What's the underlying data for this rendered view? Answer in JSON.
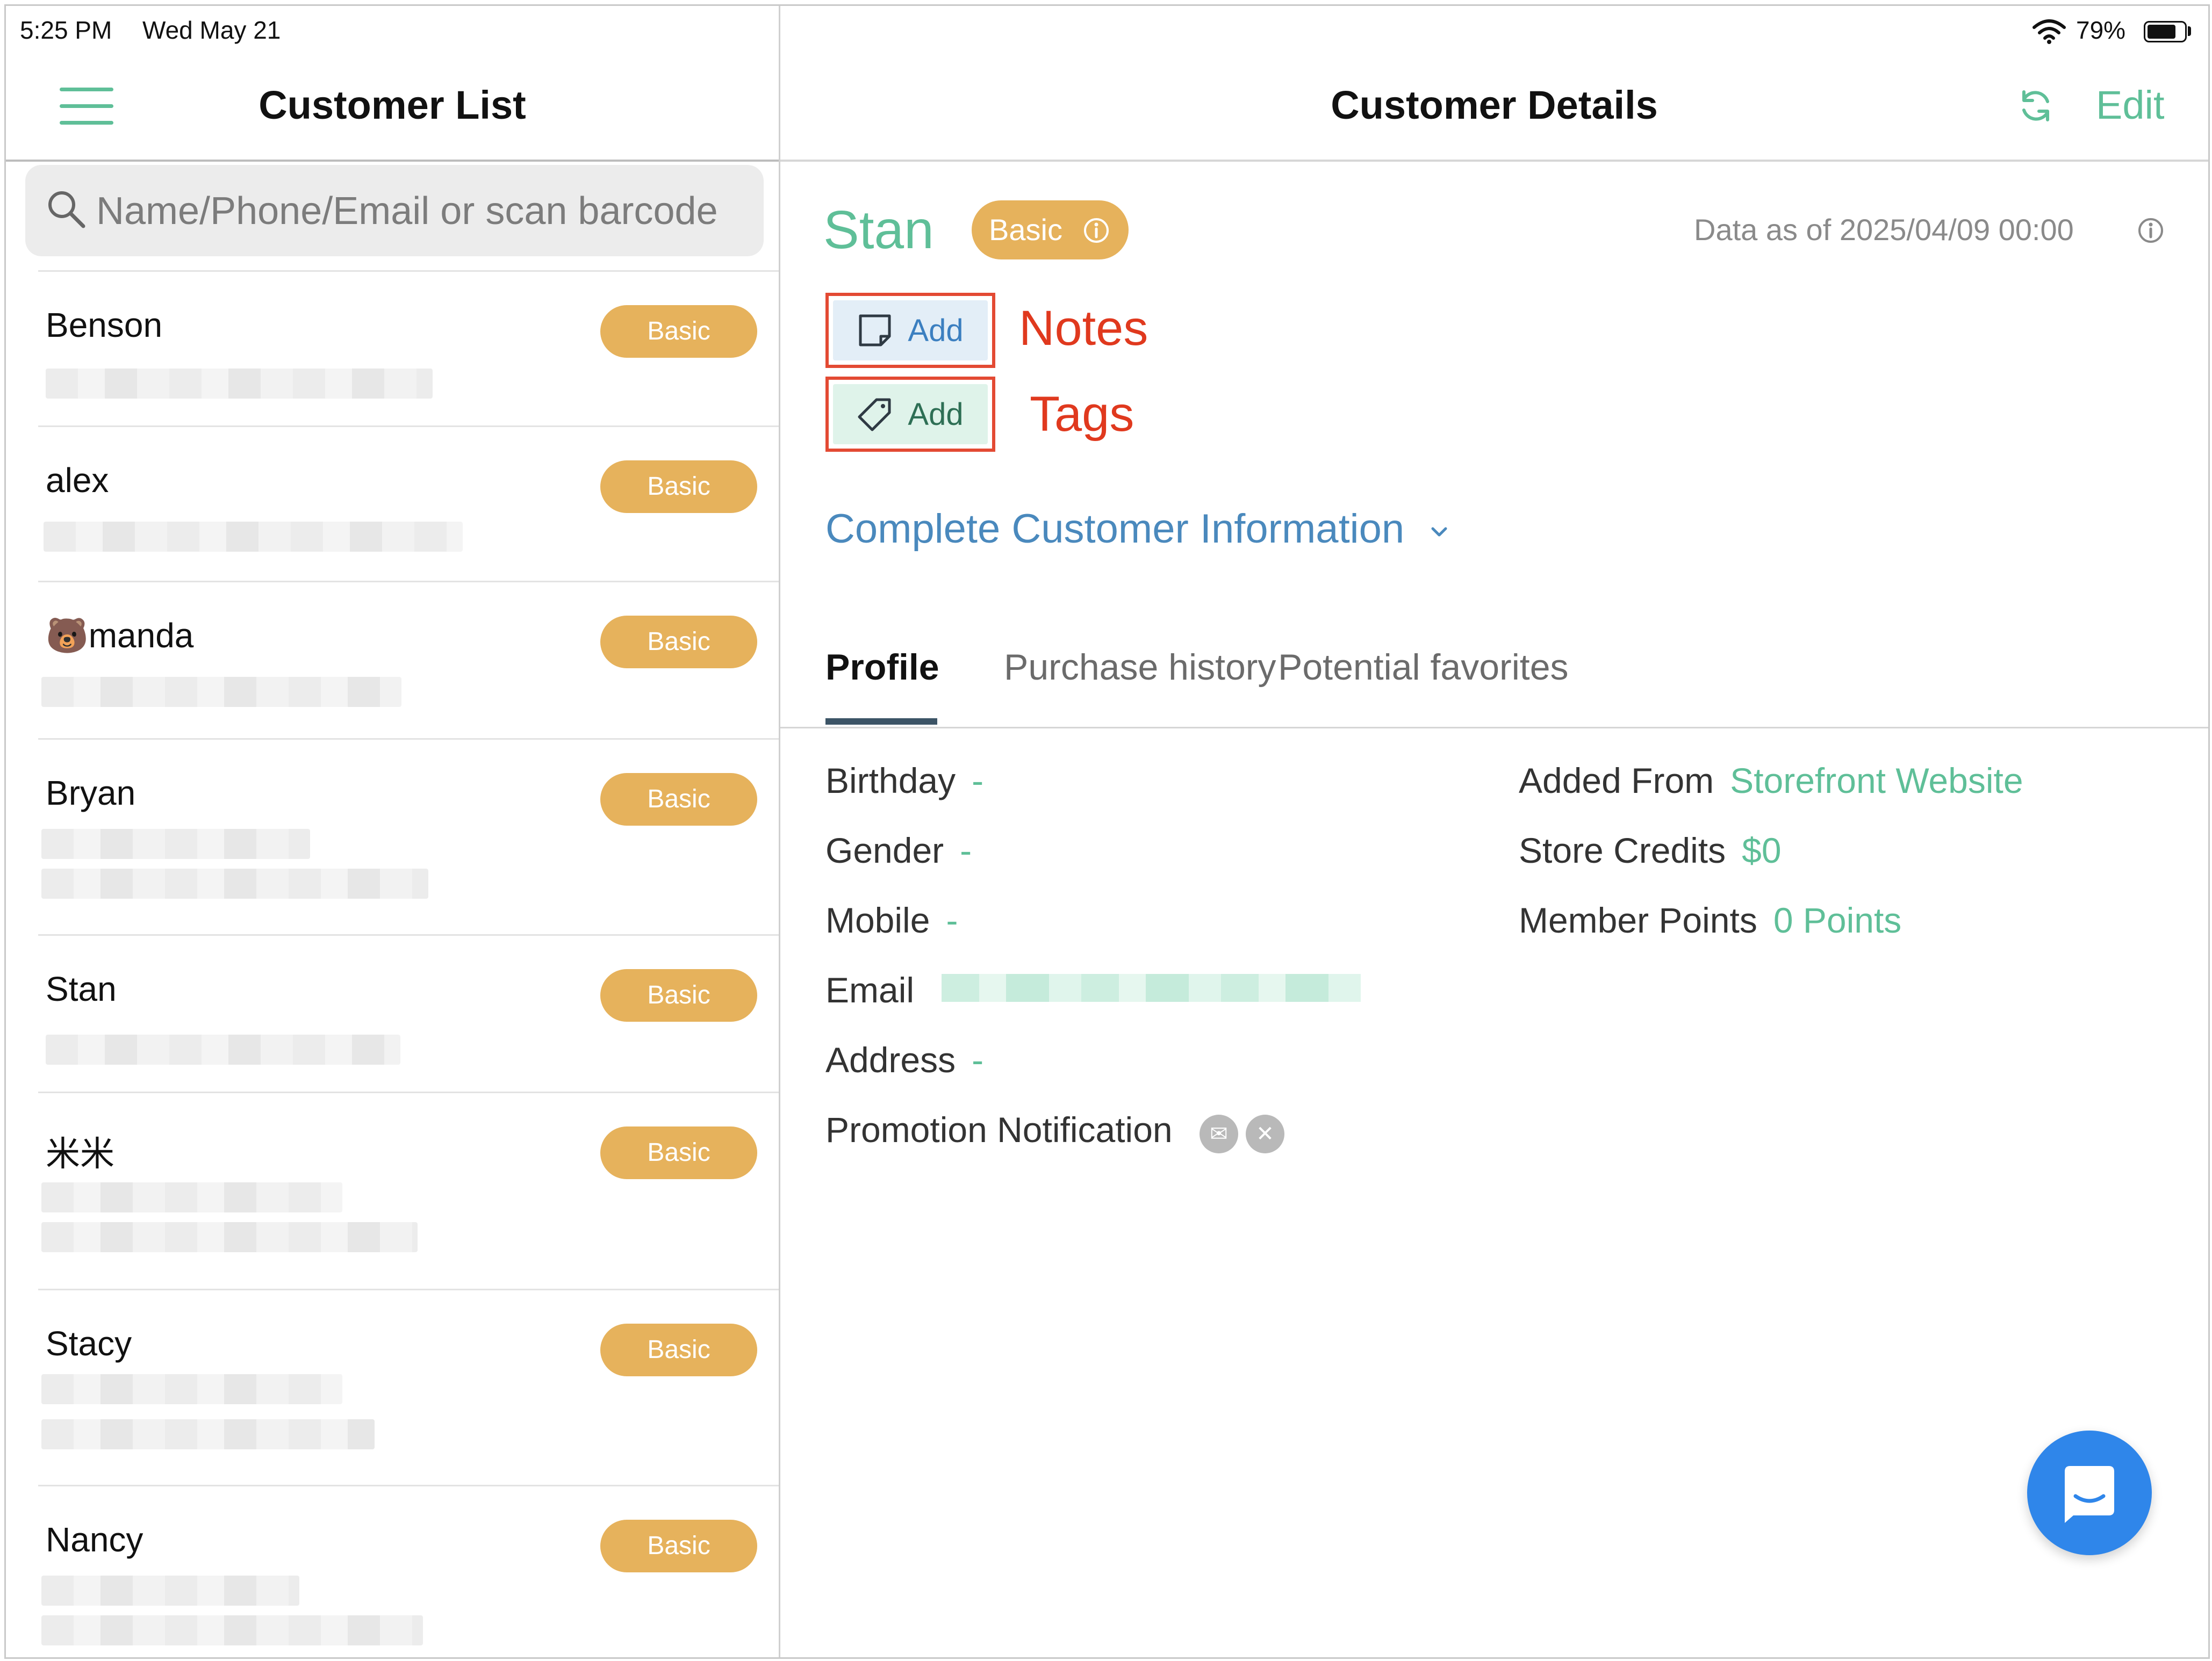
{
  "status_bar": {
    "time": "5:25 PM",
    "date": "Wed May 21",
    "battery": "79%",
    "battery_level": 0.79
  },
  "left": {
    "title": "Customer List",
    "search_placeholder": "Name/Phone/Email or scan barcode",
    "customers": [
      {
        "name": "Benson",
        "tier": "Basic"
      },
      {
        "name": "alex",
        "tier": "Basic"
      },
      {
        "name": "🐻manda",
        "tier": "Basic"
      },
      {
        "name": "Bryan",
        "tier": "Basic"
      },
      {
        "name": "Stan",
        "tier": "Basic"
      },
      {
        "name": "米米",
        "tier": "Basic"
      },
      {
        "name": "Stacy",
        "tier": "Basic"
      },
      {
        "name": "Nancy",
        "tier": "Basic"
      }
    ]
  },
  "right": {
    "title": "Customer Details",
    "edit_label": "Edit",
    "customer_name": "Stan",
    "tier": "Basic",
    "data_as_of": "Data as of 2025/04/09 00:00",
    "notes_button": "Add",
    "tags_button": "Add",
    "annotation_notes": "Notes",
    "annotation_tags": "Tags",
    "complete_info": "Complete Customer Information",
    "tabs": [
      "Profile",
      "Purchase history",
      "Potential favorites"
    ],
    "profile": {
      "birthday_label": "Birthday",
      "birthday_value": "-",
      "gender_label": "Gender",
      "gender_value": "-",
      "mobile_label": "Mobile",
      "mobile_value": "-",
      "email_label": "Email",
      "address_label": "Address",
      "address_value": "-",
      "promo_label": "Promotion Notification",
      "added_from_label": "Added From",
      "added_from_value": "Storefront Website",
      "store_credits_label": "Store Credits",
      "store_credits_value": "$0",
      "member_points_label": "Member Points",
      "member_points_value": "0 Points"
    }
  },
  "colors": {
    "accent": "#5fbf98",
    "badge": "#e6b25c",
    "link": "#4a89bd",
    "annotation": "#e0391e",
    "fab": "#2f86ea"
  }
}
